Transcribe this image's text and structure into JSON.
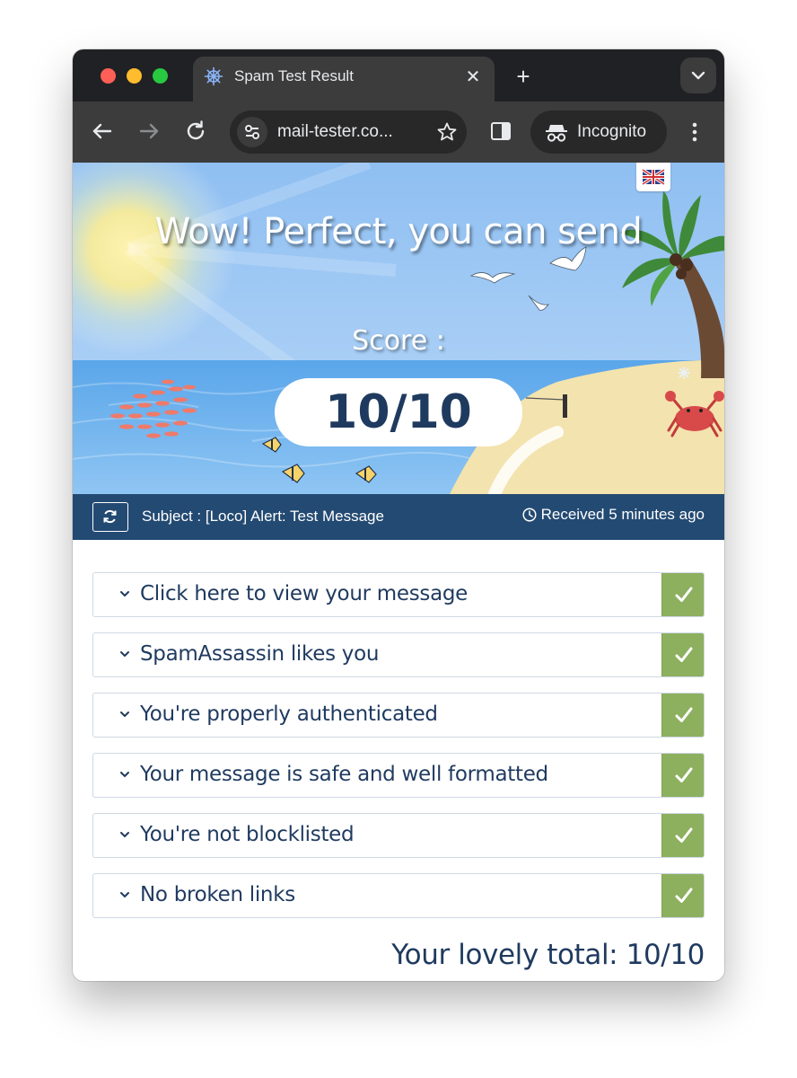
{
  "browser": {
    "tab_title": "Spam Test Result",
    "url": "mail-tester.co...",
    "incognito_label": "Incognito",
    "new_tab_glyph": "+",
    "close_glyph": "✕"
  },
  "hero": {
    "title": "Wow! Perfect, you can send",
    "score_label": "Score :",
    "score": "10/10",
    "language_flag": "uk-flag-icon"
  },
  "info_bar": {
    "subject": "Subject : [Loco] Alert: Test Message",
    "received": "Received 5 minutes ago"
  },
  "results": [
    {
      "label": "Click here to view your message",
      "status": "pass"
    },
    {
      "label": "SpamAssassin likes you",
      "status": "pass"
    },
    {
      "label": "You're properly authenticated",
      "status": "pass"
    },
    {
      "label": "Your message is safe and well formatted",
      "status": "pass"
    },
    {
      "label": "You're not blocklisted",
      "status": "pass"
    },
    {
      "label": "No broken links",
      "status": "pass"
    }
  ],
  "total": "Your lovely total: 10/10",
  "colors": {
    "navy": "#234a72",
    "text": "#1f3a5f",
    "check_green": "#8db05f",
    "sky": "#a8cdf5",
    "sea": "#6aaee8",
    "sand": "#f3e3ae"
  }
}
